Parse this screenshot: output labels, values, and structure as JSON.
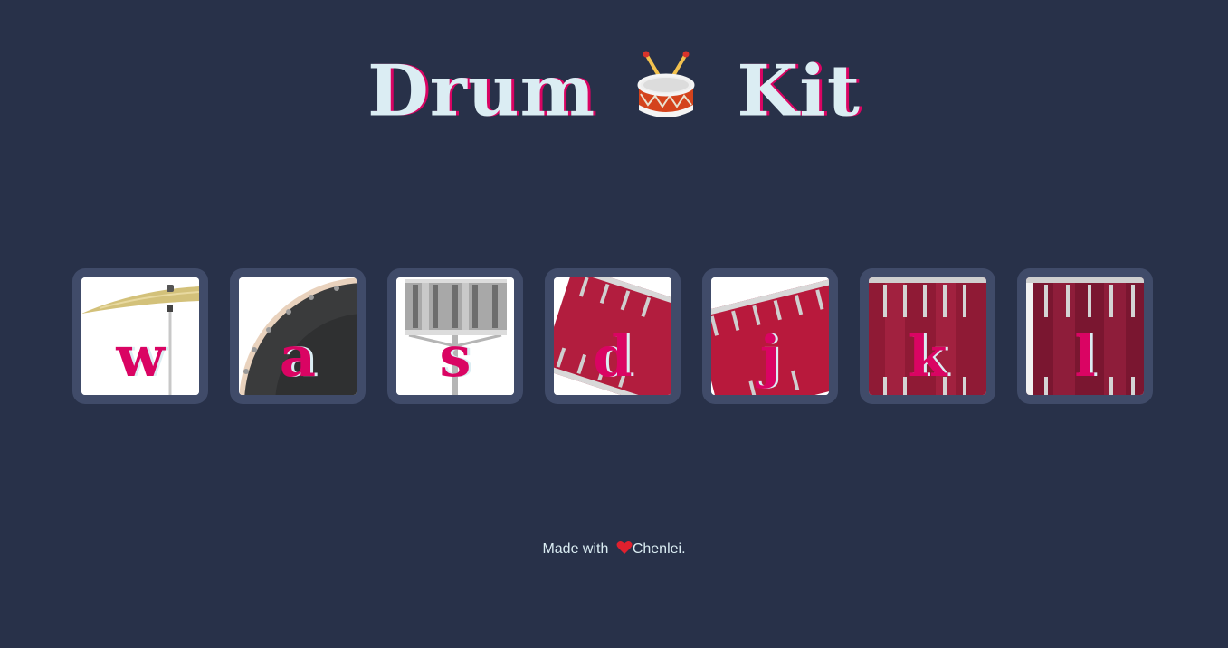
{
  "header": {
    "title_part1": "Drum",
    "title_part2": "Kit",
    "title_icon": "drum-emoji-icon"
  },
  "drums": [
    {
      "key": "w",
      "instrument": "crash"
    },
    {
      "key": "a",
      "instrument": "kick"
    },
    {
      "key": "s",
      "instrument": "snare"
    },
    {
      "key": "d",
      "instrument": "tom-1"
    },
    {
      "key": "j",
      "instrument": "tom-2"
    },
    {
      "key": "k",
      "instrument": "tom-3"
    },
    {
      "key": "l",
      "instrument": "tom-4"
    }
  ],
  "footer": {
    "text_prefix": "Made with",
    "heart_icon": "heart-icon",
    "author": "Chenlei."
  },
  "colors": {
    "background": "#283149",
    "tile": "#404b69",
    "accent": "#da0463",
    "text": "#dbedf3"
  }
}
